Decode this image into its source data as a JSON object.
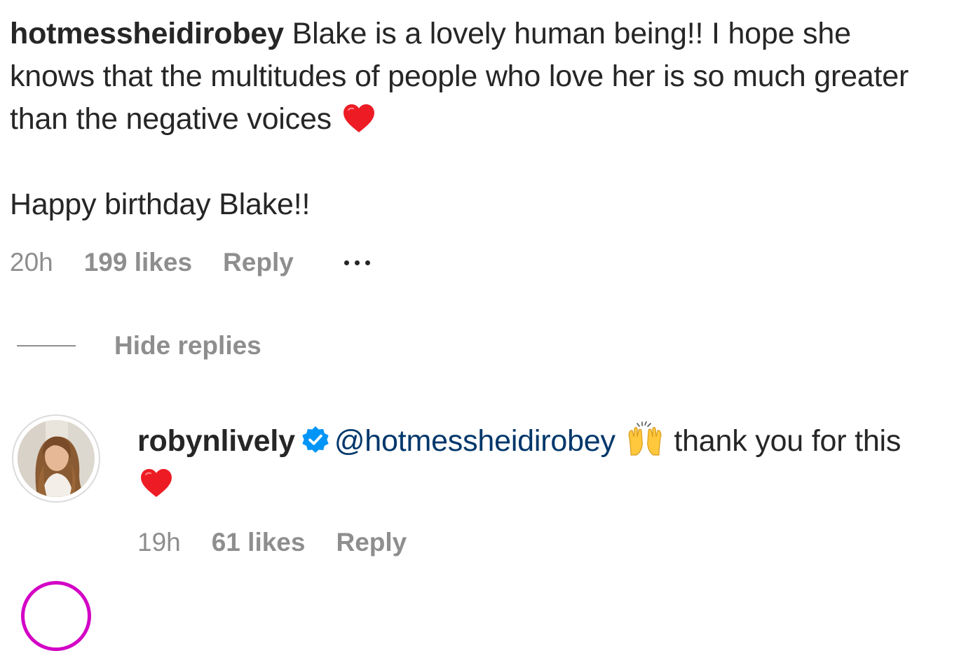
{
  "comment": {
    "username": "hotmessheidirobey",
    "text": "Blake is a lovely human being!! I hope she knows that the multitudes of people who love her is so much greater than the negative voices",
    "emoji": "heart-icon",
    "line2": "Happy birthday Blake!!",
    "time": "20h",
    "likes": "199 likes",
    "reply_label": "Reply"
  },
  "replies_toggle": {
    "label": "Hide replies"
  },
  "reply": {
    "username": "robynlively",
    "verified": true,
    "mention": "@hotmessheidirobey",
    "text_after_emoji": "thank you for this",
    "emoji_1": "raising-hands-icon",
    "emoji_2": "heart-icon",
    "time": "19h",
    "likes": "61 likes",
    "reply_label": "Reply"
  },
  "colors": {
    "text": "#262626",
    "secondary": "#8e8e8e",
    "mention": "#00376b",
    "verified": "#0095f6",
    "heart": "#ed1c24",
    "story_ring": "#d300c5"
  }
}
